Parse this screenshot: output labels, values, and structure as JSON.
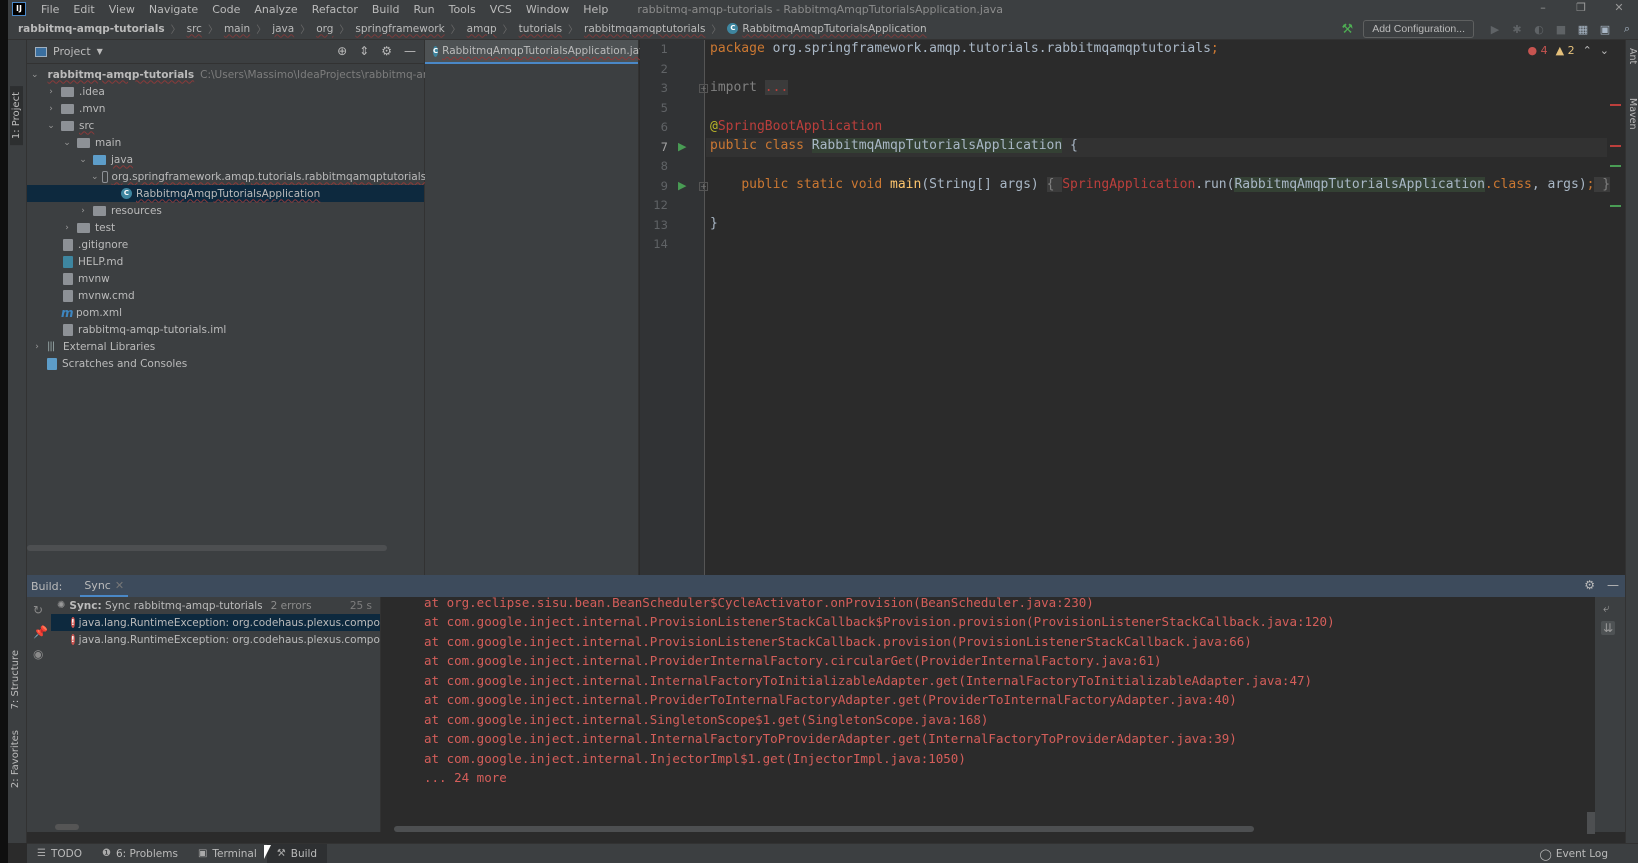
{
  "app": {
    "logo": "IJ",
    "window_title": "rabbitmq-amqp-tutorials - RabbitmqAmqpTutorialsApplication.java",
    "window_controls": {
      "minimize": "–",
      "restore": "❐",
      "close": "✕"
    }
  },
  "menu": [
    "File",
    "Edit",
    "View",
    "Navigate",
    "Code",
    "Analyze",
    "Refactor",
    "Build",
    "Run",
    "Tools",
    "VCS",
    "Window",
    "Help"
  ],
  "breadcrumb": [
    "rabbitmq-amqp-tutorials",
    "src",
    "main",
    "java",
    "org",
    "springframework",
    "amqp",
    "tutorials",
    "rabbitmqamqptutorials",
    "RabbitmqAmqpTutorialsApplication"
  ],
  "toolbar": {
    "add_configuration": "Add Configuration...",
    "icons": [
      "hammer-icon",
      "run-icon",
      "debug-icon",
      "coverage-icon",
      "stop-icon",
      "project-structure-icon",
      "terminal-window-icon",
      "search-icon"
    ]
  },
  "left_strip": {
    "project_tab": "1: Project",
    "structure_tab": "7: Structure",
    "favorites_tab": "2: Favorites"
  },
  "right_strip": {
    "ant_tab": "Ant",
    "maven_tab": "Maven"
  },
  "project_panel": {
    "title": "Project",
    "tree": [
      {
        "label": "rabbitmq-amqp-tutorials",
        "hint": "C:\\Users\\Massimo\\IdeaProjects\\rabbitmq-amqp-tuto",
        "type": "module",
        "depth": 0,
        "expanded": true
      },
      {
        "label": ".idea",
        "type": "folder",
        "depth": 1,
        "expanded": false
      },
      {
        "label": ".mvn",
        "type": "folder",
        "depth": 1,
        "expanded": false
      },
      {
        "label": "src",
        "type": "folder",
        "depth": 1,
        "expanded": true
      },
      {
        "label": "main",
        "type": "folder",
        "depth": 2,
        "expanded": true
      },
      {
        "label": "java",
        "type": "source-folder",
        "depth": 3,
        "expanded": true
      },
      {
        "label": "org.springframework.amqp.tutorials.rabbitmqamqptutorials",
        "type": "package",
        "depth": 4,
        "expanded": true
      },
      {
        "label": "RabbitmqAmqpTutorialsApplication",
        "type": "class",
        "depth": 5,
        "selected": true
      },
      {
        "label": "resources",
        "type": "resources-folder",
        "depth": 3,
        "expanded": false
      },
      {
        "label": "test",
        "type": "folder",
        "depth": 2,
        "expanded": false
      },
      {
        "label": ".gitignore",
        "type": "file",
        "depth": 1
      },
      {
        "label": "HELP.md",
        "type": "markdown",
        "depth": 1
      },
      {
        "label": "mvnw",
        "type": "script",
        "depth": 1
      },
      {
        "label": "mvnw.cmd",
        "type": "file",
        "depth": 1
      },
      {
        "label": "pom.xml",
        "type": "maven",
        "depth": 1
      },
      {
        "label": "rabbitmq-amqp-tutorials.iml",
        "type": "iml",
        "depth": 1
      },
      {
        "label": "External Libraries",
        "type": "libraries",
        "depth": 0,
        "expanded": false
      },
      {
        "label": "Scratches and Consoles",
        "type": "scratches",
        "depth": 0
      }
    ]
  },
  "editor": {
    "tab_label": "RabbitmqAmqpTutorialsApplication.java",
    "inspections": {
      "errors": "4",
      "warnings": "2"
    },
    "lines": [
      {
        "num": "1",
        "text": "package org.springframework.amqp.tutorials.rabbitmqamqptutorials;"
      },
      {
        "num": "2",
        "text": ""
      },
      {
        "num": "3",
        "text": "import ..."
      },
      {
        "num": "5",
        "text": ""
      },
      {
        "num": "6",
        "text": "@SpringBootApplication"
      },
      {
        "num": "7",
        "text": "public class RabbitmqAmqpTutorialsApplication {"
      },
      {
        "num": "8",
        "text": ""
      },
      {
        "num": "9",
        "text": "    public static void main(String[] args) { SpringApplication.run(RabbitmqAmqpTutorialsApplication.class, args); }"
      },
      {
        "num": "12",
        "text": ""
      },
      {
        "num": "13",
        "text": "}"
      },
      {
        "num": "14",
        "text": ""
      }
    ],
    "tokens": {
      "package_kw": "package",
      "package_name": " org.springframework.amqp.tutorials.rabbitmqamqptutorials",
      "semi": ";",
      "import_kw": "import",
      "import_dots": "...",
      "at": "@",
      "annotation": "SpringBootApplication",
      "public_class": "public class ",
      "class_name": "RabbitmqAmqpTutorialsApplication",
      "open_brace": " {",
      "main_sig_kw": "public static void ",
      "main_name": "main",
      "main_params": "(String[] args) ",
      "fold_open": "{ ",
      "spring_app": "SpringApplication",
      "run_call": ".run(",
      "class_kw": ".class",
      "args_end": ", args)",
      "fold_close": " }",
      "close_brace": "}"
    }
  },
  "build": {
    "label": "Build:",
    "tab": "Sync",
    "tree": [
      {
        "prefix": "Sync:",
        "label": "Sync rabbitmq-amqp-tutorials",
        "meta": "2 errors",
        "time": "25 s"
      },
      {
        "label": "java.lang.RuntimeException: org.codehaus.plexus.component.rep",
        "selected": true
      },
      {
        "label": "java.lang.RuntimeException: org.codehaus.plexus.component.rep"
      }
    ],
    "console": [
      "at org.eclipse.sisu.bean.BeanScheduler$CycleActivator.onProvision(BeanScheduler.java:230)",
      "at com.google.inject.internal.ProvisionListenerStackCallback$Provision.provision(ProvisionListenerStackCallback.java:120)",
      "at com.google.inject.internal.ProvisionListenerStackCallback.provision(ProvisionListenerStackCallback.java:66)",
      "at com.google.inject.internal.ProviderInternalFactory.circularGet(ProviderInternalFactory.java:61)",
      "at com.google.inject.internal.InternalFactoryToInitializableAdapter.get(InternalFactoryToInitializableAdapter.java:47)",
      "at com.google.inject.internal.ProviderToInternalFactoryAdapter.get(ProviderToInternalFactoryAdapter.java:40)",
      "at com.google.inject.internal.SingletonScope$1.get(SingletonScope.java:168)",
      "at com.google.inject.internal.InternalFactoryToProviderAdapter.get(InternalFactoryToProviderAdapter.java:39)",
      "at com.google.inject.internal.InjectorImpl$1.get(InjectorImpl.java:1050)",
      "... 24 more"
    ]
  },
  "bottom_bar": {
    "tabs": [
      {
        "label": "TODO",
        "icon": "list-icon"
      },
      {
        "label": "6: Problems",
        "icon": "problems-icon"
      },
      {
        "label": "Terminal",
        "icon": "terminal-icon"
      },
      {
        "label": "Build",
        "icon": "hammer-icon",
        "active": true
      }
    ],
    "event_log": "Event Log"
  }
}
